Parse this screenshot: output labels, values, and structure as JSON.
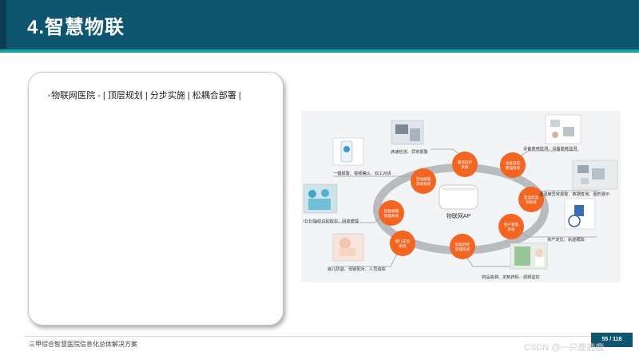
{
  "header": {
    "title": "4.智慧物联"
  },
  "card": {
    "bullet": "物联网医院 - | 顶层规划 | 分步实施 |  松耦合部署 |"
  },
  "diagram": {
    "center_label": "物联网AP",
    "systems": [
      {
        "label1": "输液监护",
        "label2": "系统"
      },
      {
        "label1": "设备巡检",
        "label2": "管理系统"
      },
      {
        "label1": "温湿度监",
        "label2": "测系统"
      },
      {
        "label1": "资产管理",
        "label2": "系统"
      },
      {
        "label1": "智能药柜",
        "label2": "管理系统"
      },
      {
        "label1": "婴儿安全",
        "label2": "系统"
      },
      {
        "label1": "智能被服",
        "label2": "管理系统"
      },
      {
        "label1": "无线报警",
        "label2": "求助系统"
      }
    ],
    "captions": [
      "滴速检测、异常报警",
      "设备使用监测、设备能耗监测",
      "温湿度异常报警、数据查询、图形展示",
      "资产定位、轨迹跟踪",
      "药品追溯、定制药柜、视频监控",
      "婴儿防盗、母婴配对、人员追踪",
      "ID卡/指纹识别取衣、回收管理",
      "一键报警、视频确认、双工对讲"
    ],
    "colors": {
      "node": "#f26522",
      "ring": "#b9bbbe",
      "line": "#9a9a9a",
      "panel": "#f3f4f6"
    }
  },
  "footer": {
    "text": "三甲综合智慧医院信息化总体解决方案",
    "page": "55 / 118",
    "watermark": "CSDN @一只鹿鹿鹿"
  }
}
